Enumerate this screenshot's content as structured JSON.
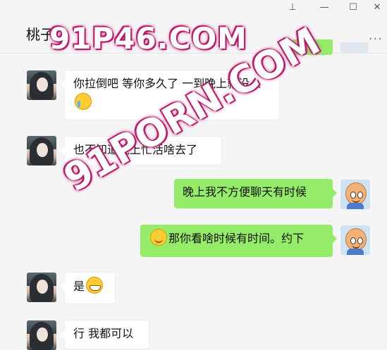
{
  "window": {
    "pin_icon": "pin-icon",
    "minimize_icon": "minimize-icon",
    "maximize_icon": "maximize-icon",
    "close_icon": "close-icon"
  },
  "header": {
    "title": "桃子",
    "more_label": "..."
  },
  "messages": [
    {
      "side": "left",
      "text": "你拉倒吧 等你多久了 一到晚上就没人",
      "emoji": "crying-laughing-emoji"
    },
    {
      "side": "left",
      "text": "也不知道晚上忙活啥去了"
    },
    {
      "side": "right",
      "text": "晚上我不方便聊天有时候"
    },
    {
      "side": "right",
      "text": "那你看啥时候有时间。约下",
      "emoji": "smile-emoji"
    },
    {
      "side": "left",
      "text": "是",
      "emoji": "grin-emoji"
    },
    {
      "side": "left",
      "text": "行 我都可以"
    }
  ],
  "watermarks": [
    "91P46.COM",
    "91PORN.COM"
  ],
  "colors": {
    "background": "#f5f5f5",
    "sent_bubble": "#95ec69",
    "received_bubble": "#ffffff"
  }
}
